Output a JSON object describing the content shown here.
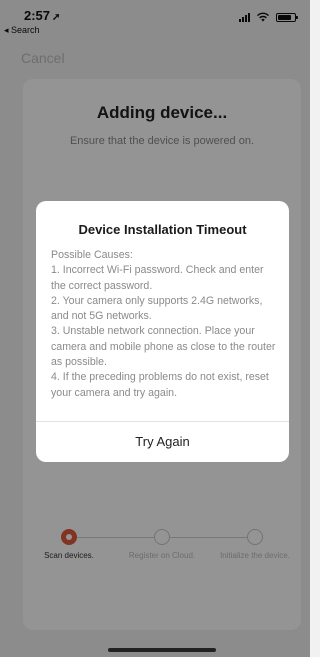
{
  "status_bar": {
    "time": "2:57",
    "back_label": "◂ Search"
  },
  "header": {
    "cancel_label": "Cancel"
  },
  "card": {
    "title": "Adding device...",
    "subtitle": "Ensure that the device is powered on."
  },
  "steps": [
    {
      "label": "Scan devices.",
      "state": "active"
    },
    {
      "label": "Register on Cloud.",
      "state": "pending"
    },
    {
      "label": "Initialize the device.",
      "state": "pending"
    }
  ],
  "dialog": {
    "title": "Device Installation Timeout",
    "lines": [
      "Possible Causes:",
      "1. Incorrect Wi-Fi password. Check and enter the correct password.",
      "2. Your camera only supports 2.4G networks, and not 5G networks.",
      "3. Unstable network connection. Place your camera and mobile phone as close to the router as possible.",
      "4. If the preceding problems do not exist, reset your camera and try again."
    ],
    "button": "Try Again"
  },
  "colors": {
    "accent": "#e0583a"
  }
}
